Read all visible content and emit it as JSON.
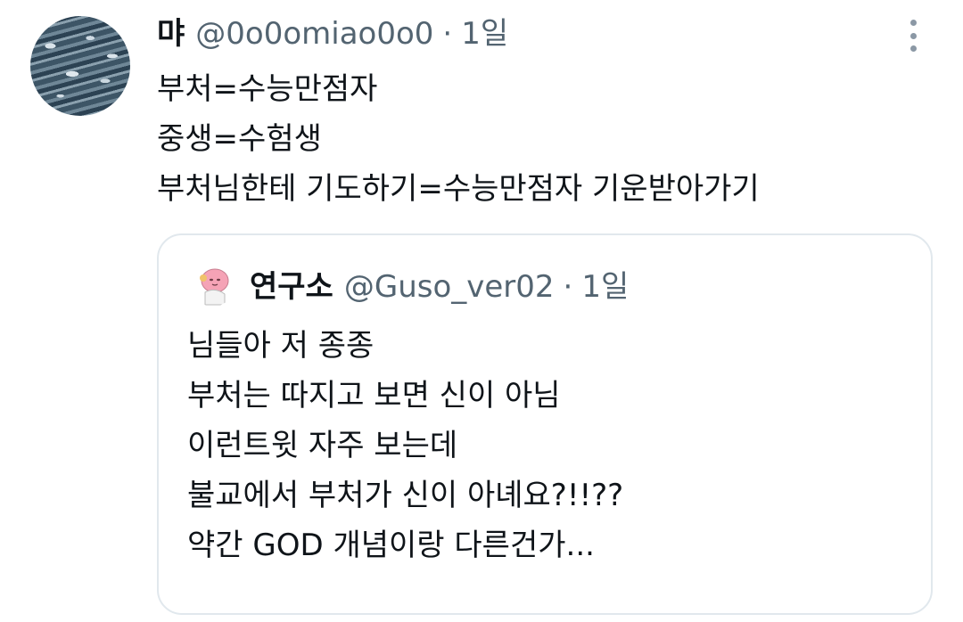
{
  "tweet": {
    "display_name": "먀",
    "handle": "@0o0omiao0o0",
    "separator": "·",
    "time": "1일",
    "avatar_icon": "avatar-water-texture",
    "more_icon": "more-vertical-icon",
    "lines": [
      "부처=수능만점자",
      "중생=수험생",
      "부처님한테 기도하기=수능만점자 기운받아가기"
    ]
  },
  "quote": {
    "display_name": "연구소",
    "handle": "@Guso_ver02",
    "separator": "·",
    "time": "1일",
    "avatar_icon": "pink-character-avatar",
    "lines": [
      "님들아 저 종종",
      "부처는 따지고 보면 신이 아님",
      "이런트윗 자주 보는데",
      "불교에서 부처가 신이 아녜요?!!??",
      "약간 GOD 개념이랑 다른건가..."
    ]
  },
  "colors": {
    "text": "#0f1419",
    "secondary": "#536471",
    "border": "#e1e8ed",
    "avatar_pink": "#f5a3b6"
  }
}
